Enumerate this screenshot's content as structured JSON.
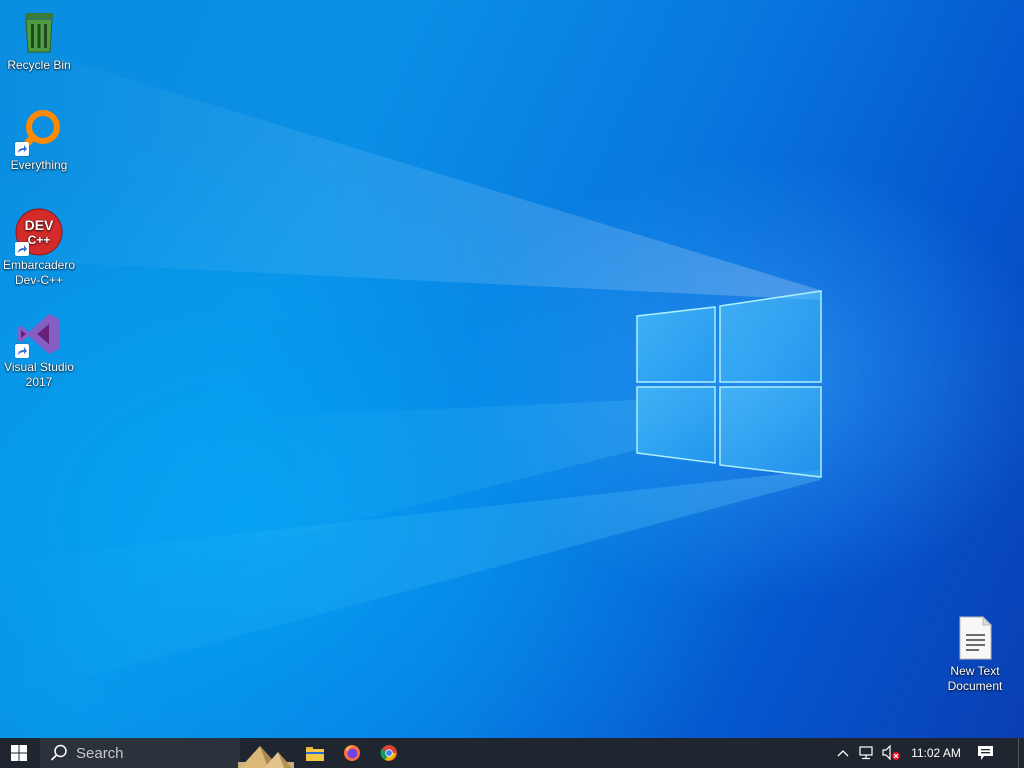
{
  "desktop": {
    "icons": [
      {
        "label": "Recycle Bin",
        "icon": "recycle-bin-icon"
      },
      {
        "label": "Everything",
        "icon": "everything-search-icon"
      },
      {
        "label_line1": "Embarcadero",
        "label_line2": "Dev-C++",
        "icon": "dev-cpp-icon",
        "badge_text": "DEV",
        "badge_text2": "C++"
      },
      {
        "label_line1": "Visual Studio",
        "label_line2": "2017",
        "icon": "visual-studio-icon"
      },
      {
        "label_line1": "New Text",
        "label_line2": "Document",
        "icon": "text-document-icon"
      }
    ]
  },
  "taskbar": {
    "search_placeholder": "Search",
    "clock_time": "11:02 AM",
    "pinned": [
      {
        "name": "file-explorer-icon"
      },
      {
        "name": "firefox-icon"
      },
      {
        "name": "chrome-icon"
      }
    ]
  },
  "colors": {
    "taskbar_bg": "#1f2630",
    "wallpaper_accent": "#0a8fe6"
  }
}
